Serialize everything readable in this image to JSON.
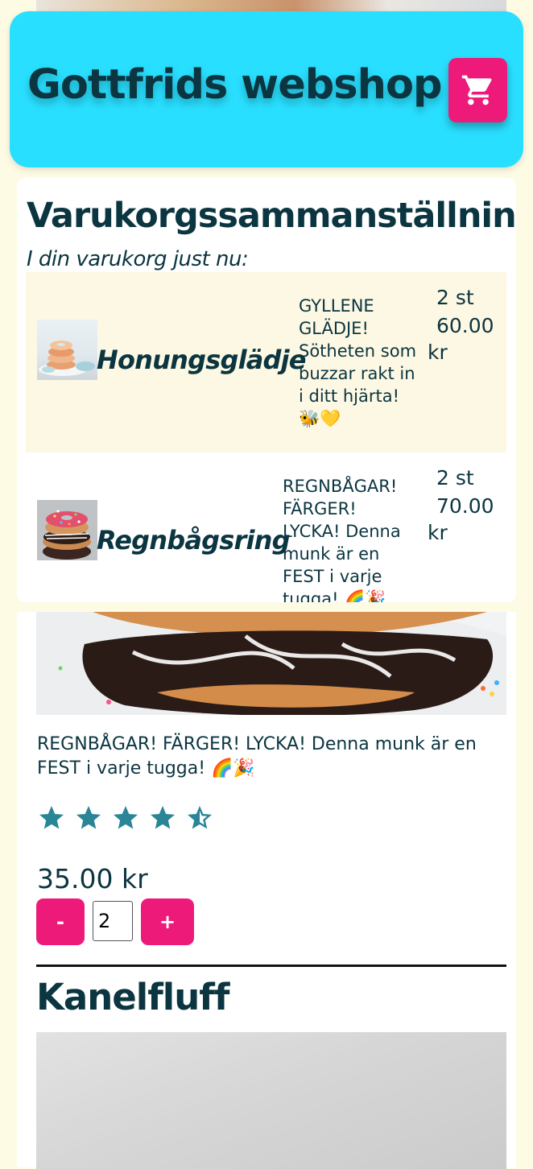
{
  "header": {
    "title": "Gottfrids webshop",
    "cart_icon": "shopping-cart-icon",
    "background_color": "#29dfff",
    "accent_color": "#ee1a7a"
  },
  "cart_summary": {
    "title": "Varukorgssammanställning",
    "subtitle": "I din varukorg just nu:",
    "items": [
      {
        "name": "Honungsglädje",
        "description": "GYLLENE GLÄDJE! Sötheten som buzzar rakt in i ditt hjärta! 🐝💛",
        "quantity": "2 st",
        "total": "60.00 kr"
      },
      {
        "name": "Regnbågsring",
        "description": "REGNBÅGAR! FÄRGER! LYCKA! Denna munk är en FEST i varje tugga! 🌈🎉",
        "quantity": "2 st",
        "total": "70.00 kr"
      }
    ]
  },
  "product": {
    "description": "REGNBÅGAR! FÄRGER! LYCKA! Denna munk är en FEST i varje tugga! 🌈🎉",
    "rating": 4.5,
    "rating_max": 5,
    "price": "35.00 kr",
    "quantity": "2",
    "minus_label": "-",
    "plus_label": "+"
  },
  "next_product": {
    "title": "Kanelfluff"
  }
}
